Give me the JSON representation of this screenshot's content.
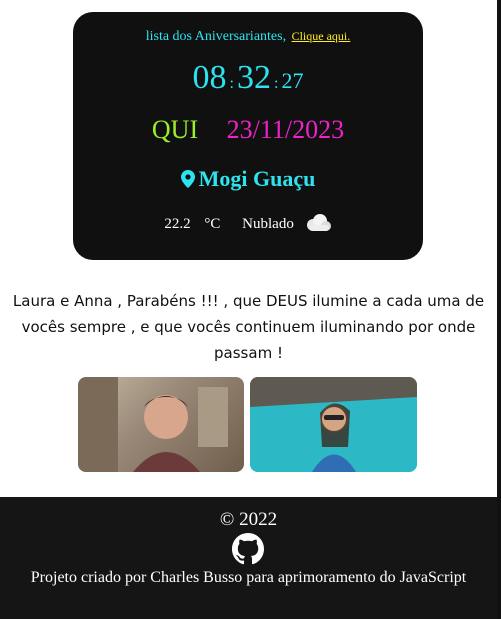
{
  "card": {
    "list_text": "lista dos Aniversariantes,",
    "list_link": "Clique aqui.",
    "clock": {
      "hours": "08",
      "sep1": ":",
      "minutes": "32",
      "sep2": ":",
      "seconds": "27"
    },
    "weekday": "QUI",
    "date": "23/11/2023",
    "city": "Mogi Guaçu",
    "temperature": "22.2",
    "unit": "°C",
    "condition": "Nublado"
  },
  "message": "Laura e Anna , Parabéns !!! , que DEUS ilumine a cada uma de vocês sempre , e que vocês continuem iluminando por onde passam !",
  "footer": {
    "copyright": "© 2022",
    "credit": "Projeto criado por Charles Busso para aprimoramento do JavaScript"
  },
  "colors": {
    "accent_cyan": "#2ee3f0",
    "day_green": "#9bef2a",
    "date_magenta": "#ee22c8",
    "link_yellow": "#ffee22"
  }
}
